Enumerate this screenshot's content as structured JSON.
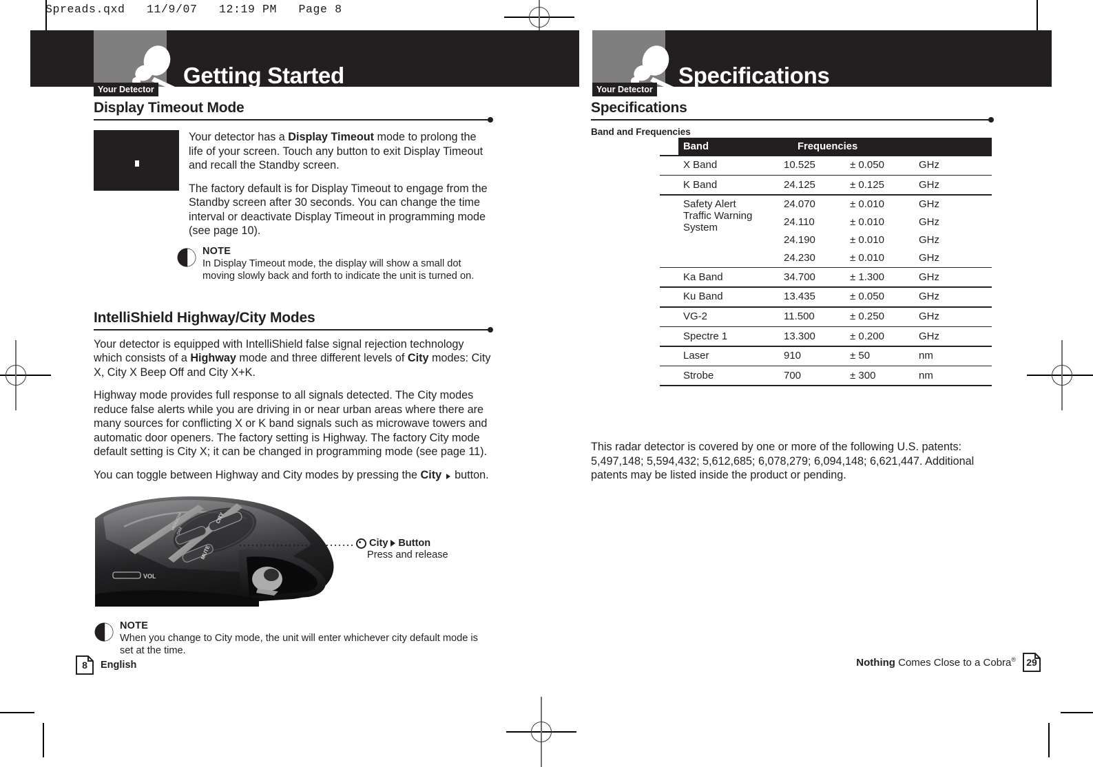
{
  "print_slug": "Spreads.qxd   11/9/07   12:19 PM   Page 8",
  "left_page": {
    "band": {
      "tab_label": "Your Detector",
      "title": "Getting Started",
      "icon": "detector-icon"
    },
    "sections": [
      {
        "heading": "Display Timeout Mode",
        "screen_caption": "display-timeout-screen",
        "paragraphs": [
          "Your detector has a Display Timeout mode to prolong the life of your screen. Touch any button to exit Display Timeout and recall the Standby screen.",
          "The factory default is for Display Timeout to engage from the Standby screen after 30 seconds. You can change the time interval or deactivate Display Timeout in programming mode (see page 10)."
        ],
        "note": {
          "title": "NOTE",
          "text": "In Display Timeout mode, the display will show a small dot moving slowly back and forth to indicate the unit is turned on."
        }
      },
      {
        "heading": "IntelliShield Highway/City Modes",
        "paragraphs": [
          "Your detector is equipped with IntelliShield false signal rejection technology which consists of a Highway mode and three different levels of City modes: City X, City X Beep Off and City X+K.",
          "Highway mode provides full response to all signals detected. The City modes reduce false alerts while you are driving in or near urban areas where there are many sources for conflicting X or K band signals such as microwave towers and automatic door openers. The factory setting is Highway. The factory City mode default setting is City X; it can be changed in programming mode (see page 11).",
          "You can toggle between Highway and City modes by pressing the City button."
        ],
        "callout": {
          "title": "City",
          "title_suffix": "Button",
          "subtitle": "Press and release"
        },
        "note": {
          "title": "NOTE",
          "text": "When you change to City mode, the unit will enter whichever city default mode is set at the time."
        }
      }
    ],
    "footer": {
      "page_number": "8",
      "language": "English"
    }
  },
  "right_page": {
    "band": {
      "tab_label": "Your Detector",
      "title": "Specifications",
      "icon": "detector-icon"
    },
    "heading": "Specifications",
    "subheading": "Band and Frequencies",
    "table": {
      "headers": [
        "Band",
        "Frequencies"
      ],
      "rows": [
        {
          "band": "X Band",
          "freq": "10.525",
          "tol": "± 0.050",
          "unit": "GHz"
        },
        {
          "band": "K Band",
          "freq": "24.125",
          "tol": "± 0.125",
          "unit": "GHz"
        }
      ],
      "group": {
        "label_lines": [
          "Safety Alert",
          "Traffic Warning",
          "System"
        ],
        "rows": [
          {
            "freq": "24.070",
            "tol": "± 0.010",
            "unit": "GHz"
          },
          {
            "freq": "24.110",
            "tol": "± 0.010",
            "unit": "GHz"
          },
          {
            "freq": "24.190",
            "tol": "± 0.010",
            "unit": "GHz"
          },
          {
            "freq": "24.230",
            "tol": "± 0.010",
            "unit": "GHz"
          }
        ]
      },
      "rows_after": [
        {
          "band": "Ka Band",
          "freq": "34.700",
          "tol": "± 1.300",
          "unit": "GHz"
        },
        {
          "band": "Ku Band",
          "freq": "13.435",
          "tol": "± 0.050",
          "unit": "GHz"
        },
        {
          "band": "VG-2",
          "freq": "11.500",
          "tol": "± 0.250",
          "unit": "GHz"
        },
        {
          "band": "Spectre 1",
          "freq": "13.300",
          "tol": "± 0.200",
          "unit": "GHz"
        },
        {
          "band": "Laser",
          "freq": "910",
          "tol": "± 50",
          "unit": "nm"
        },
        {
          "band": "Strobe",
          "freq": "700",
          "tol": "± 300",
          "unit": "nm"
        }
      ]
    },
    "patents": "This radar detector is covered by one or more of the following U.S. patents: 5,497,148; 5,594,432; 5,612,685; 6,078,279; 6,094,148; 6,621,447. Additional patents may be listed inside the product or pending.",
    "footer": {
      "tagline_bold": "Nothing",
      "tagline_rest": " Comes Close to a Cobra",
      "tagline_mark": "®",
      "page_number": "29"
    }
  },
  "colors": {
    "ink": "#231f20",
    "tab_gray": "#7f7f7f",
    "paper": "#ffffff"
  }
}
